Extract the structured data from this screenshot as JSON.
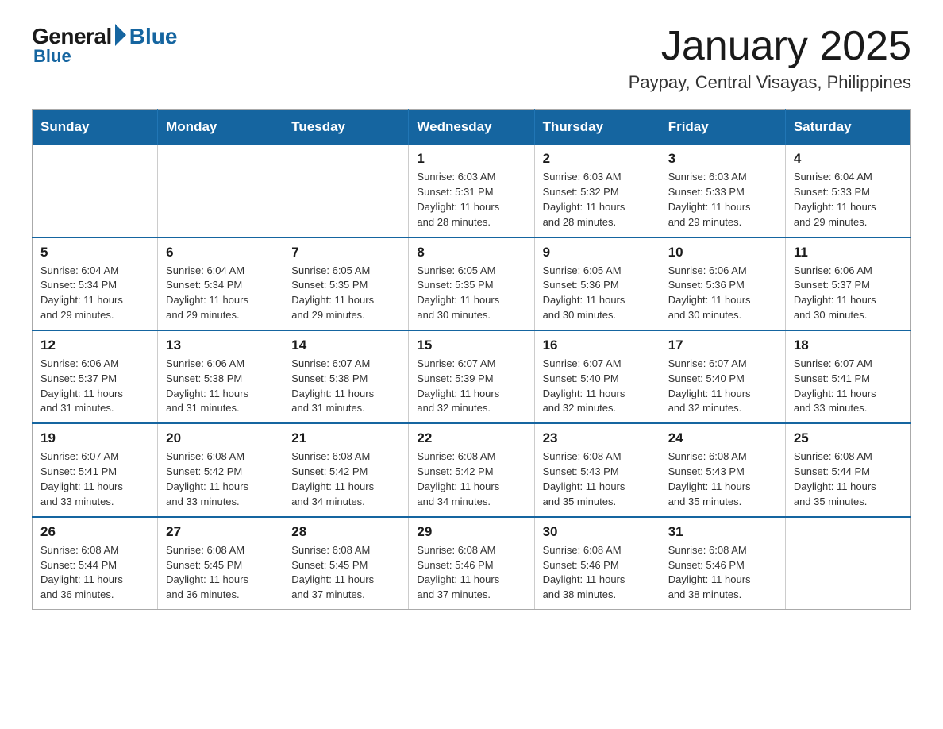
{
  "logo": {
    "general": "General",
    "blue": "Blue"
  },
  "title": "January 2025",
  "subtitle": "Paypay, Central Visayas, Philippines",
  "days_of_week": [
    "Sunday",
    "Monday",
    "Tuesday",
    "Wednesday",
    "Thursday",
    "Friday",
    "Saturday"
  ],
  "weeks": [
    [
      {
        "day": "",
        "info": ""
      },
      {
        "day": "",
        "info": ""
      },
      {
        "day": "",
        "info": ""
      },
      {
        "day": "1",
        "info": "Sunrise: 6:03 AM\nSunset: 5:31 PM\nDaylight: 11 hours\nand 28 minutes."
      },
      {
        "day": "2",
        "info": "Sunrise: 6:03 AM\nSunset: 5:32 PM\nDaylight: 11 hours\nand 28 minutes."
      },
      {
        "day": "3",
        "info": "Sunrise: 6:03 AM\nSunset: 5:33 PM\nDaylight: 11 hours\nand 29 minutes."
      },
      {
        "day": "4",
        "info": "Sunrise: 6:04 AM\nSunset: 5:33 PM\nDaylight: 11 hours\nand 29 minutes."
      }
    ],
    [
      {
        "day": "5",
        "info": "Sunrise: 6:04 AM\nSunset: 5:34 PM\nDaylight: 11 hours\nand 29 minutes."
      },
      {
        "day": "6",
        "info": "Sunrise: 6:04 AM\nSunset: 5:34 PM\nDaylight: 11 hours\nand 29 minutes."
      },
      {
        "day": "7",
        "info": "Sunrise: 6:05 AM\nSunset: 5:35 PM\nDaylight: 11 hours\nand 29 minutes."
      },
      {
        "day": "8",
        "info": "Sunrise: 6:05 AM\nSunset: 5:35 PM\nDaylight: 11 hours\nand 30 minutes."
      },
      {
        "day": "9",
        "info": "Sunrise: 6:05 AM\nSunset: 5:36 PM\nDaylight: 11 hours\nand 30 minutes."
      },
      {
        "day": "10",
        "info": "Sunrise: 6:06 AM\nSunset: 5:36 PM\nDaylight: 11 hours\nand 30 minutes."
      },
      {
        "day": "11",
        "info": "Sunrise: 6:06 AM\nSunset: 5:37 PM\nDaylight: 11 hours\nand 30 minutes."
      }
    ],
    [
      {
        "day": "12",
        "info": "Sunrise: 6:06 AM\nSunset: 5:37 PM\nDaylight: 11 hours\nand 31 minutes."
      },
      {
        "day": "13",
        "info": "Sunrise: 6:06 AM\nSunset: 5:38 PM\nDaylight: 11 hours\nand 31 minutes."
      },
      {
        "day": "14",
        "info": "Sunrise: 6:07 AM\nSunset: 5:38 PM\nDaylight: 11 hours\nand 31 minutes."
      },
      {
        "day": "15",
        "info": "Sunrise: 6:07 AM\nSunset: 5:39 PM\nDaylight: 11 hours\nand 32 minutes."
      },
      {
        "day": "16",
        "info": "Sunrise: 6:07 AM\nSunset: 5:40 PM\nDaylight: 11 hours\nand 32 minutes."
      },
      {
        "day": "17",
        "info": "Sunrise: 6:07 AM\nSunset: 5:40 PM\nDaylight: 11 hours\nand 32 minutes."
      },
      {
        "day": "18",
        "info": "Sunrise: 6:07 AM\nSunset: 5:41 PM\nDaylight: 11 hours\nand 33 minutes."
      }
    ],
    [
      {
        "day": "19",
        "info": "Sunrise: 6:07 AM\nSunset: 5:41 PM\nDaylight: 11 hours\nand 33 minutes."
      },
      {
        "day": "20",
        "info": "Sunrise: 6:08 AM\nSunset: 5:42 PM\nDaylight: 11 hours\nand 33 minutes."
      },
      {
        "day": "21",
        "info": "Sunrise: 6:08 AM\nSunset: 5:42 PM\nDaylight: 11 hours\nand 34 minutes."
      },
      {
        "day": "22",
        "info": "Sunrise: 6:08 AM\nSunset: 5:42 PM\nDaylight: 11 hours\nand 34 minutes."
      },
      {
        "day": "23",
        "info": "Sunrise: 6:08 AM\nSunset: 5:43 PM\nDaylight: 11 hours\nand 35 minutes."
      },
      {
        "day": "24",
        "info": "Sunrise: 6:08 AM\nSunset: 5:43 PM\nDaylight: 11 hours\nand 35 minutes."
      },
      {
        "day": "25",
        "info": "Sunrise: 6:08 AM\nSunset: 5:44 PM\nDaylight: 11 hours\nand 35 minutes."
      }
    ],
    [
      {
        "day": "26",
        "info": "Sunrise: 6:08 AM\nSunset: 5:44 PM\nDaylight: 11 hours\nand 36 minutes."
      },
      {
        "day": "27",
        "info": "Sunrise: 6:08 AM\nSunset: 5:45 PM\nDaylight: 11 hours\nand 36 minutes."
      },
      {
        "day": "28",
        "info": "Sunrise: 6:08 AM\nSunset: 5:45 PM\nDaylight: 11 hours\nand 37 minutes."
      },
      {
        "day": "29",
        "info": "Sunrise: 6:08 AM\nSunset: 5:46 PM\nDaylight: 11 hours\nand 37 minutes."
      },
      {
        "day": "30",
        "info": "Sunrise: 6:08 AM\nSunset: 5:46 PM\nDaylight: 11 hours\nand 38 minutes."
      },
      {
        "day": "31",
        "info": "Sunrise: 6:08 AM\nSunset: 5:46 PM\nDaylight: 11 hours\nand 38 minutes."
      },
      {
        "day": "",
        "info": ""
      }
    ]
  ]
}
